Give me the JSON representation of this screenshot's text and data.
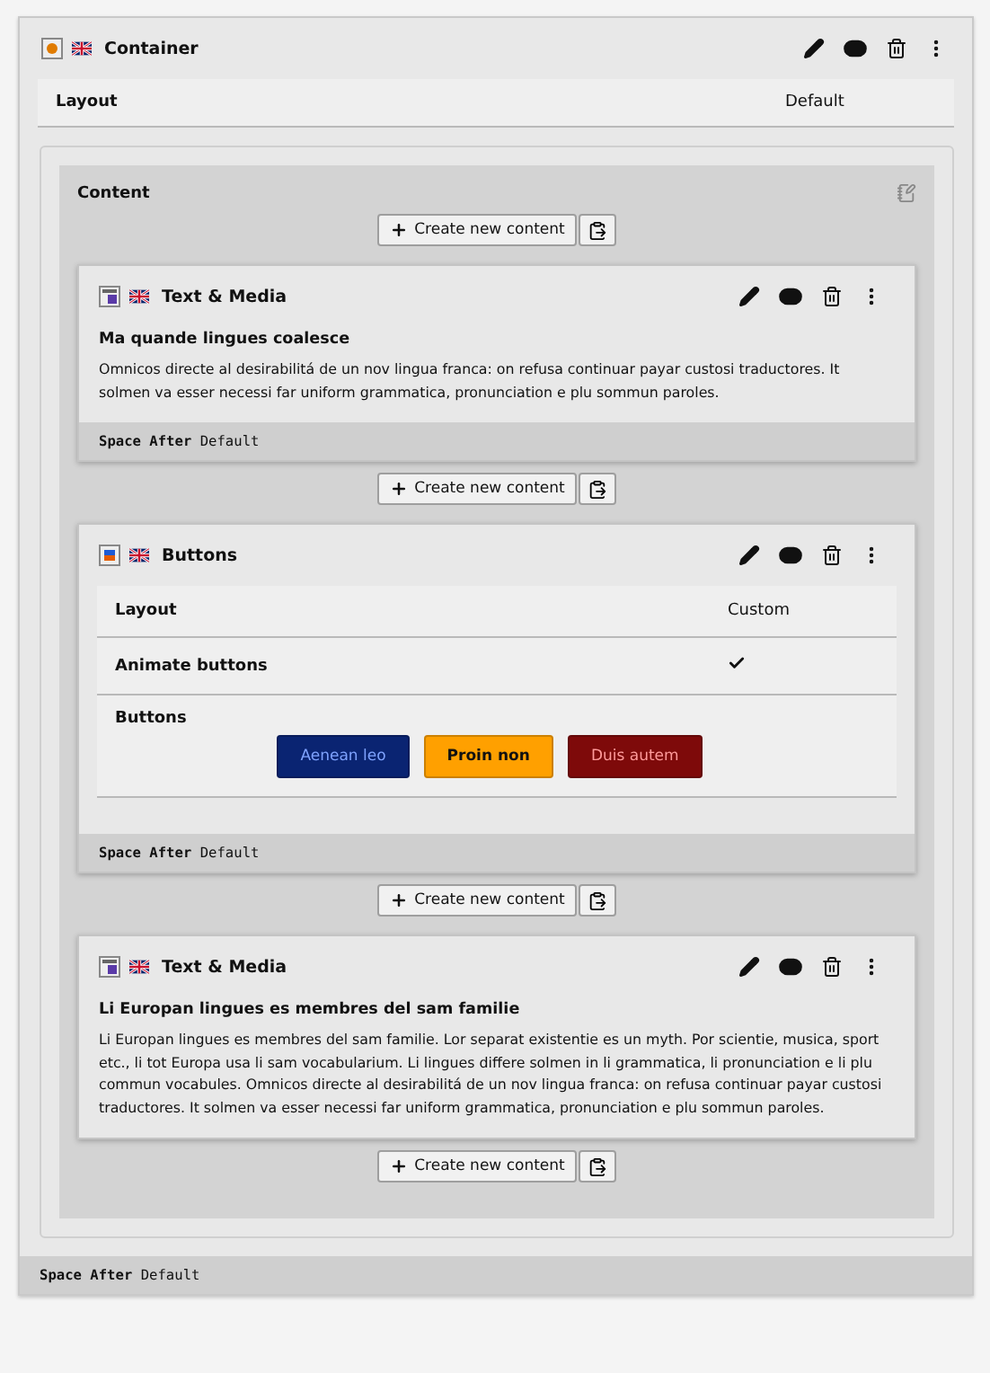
{
  "container": {
    "title": "Container",
    "layout": {
      "label": "Layout",
      "value": "Default"
    },
    "content": {
      "title": "Content",
      "create_buttons": [
        "Create new content",
        "Create new content",
        "Create new content",
        "Create new content"
      ],
      "items": [
        {
          "kind": "text_media",
          "title": "Text & Media",
          "header": "Ma quande lingues coalesce",
          "bodytext": "Omnicos directe al desirabilitá de un nov lingua franca: on refusa continuar payar custosi traductores. It solmen va esser necessi far uniform grammatica, pronunciation e plu sommun paroles.",
          "footer": {
            "label": "Space After",
            "value": "Default"
          }
        },
        {
          "kind": "buttons",
          "title": "Buttons",
          "fields": [
            {
              "kind": "text",
              "label": "Layout",
              "value": "Custom"
            },
            {
              "kind": "check",
              "label": "Animate buttons",
              "checked": true
            },
            {
              "kind": "buttons",
              "label": "Buttons",
              "buttons": [
                {
                  "label": "Aenean leo",
                  "color": "#0a2472"
                },
                {
                  "label": "Proin non",
                  "color": "#ffa000"
                },
                {
                  "label": "Duis autem",
                  "color": "#7e0a0a"
                }
              ]
            }
          ],
          "footer": {
            "label": "Space After",
            "value": "Default"
          }
        },
        {
          "kind": "text_media",
          "title": "Text & Media",
          "header": "Li Europan lingues es membres del sam familie",
          "bodytext": "Li Europan lingues es membres del sam familie. Lor separat existentie es un myth. Por scientie, musica, sport etc., li tot Europa usa li sam vocabularium. Li lingues differe solmen in li grammatica, li pronunciation e li plu commun vocabules. Omnicos directe al desirabilitá de un nov lingua franca: on refusa continuar payar custosi traductores. It solmen va esser necessi far uniform grammatica, pronunciation e plu sommun paroles."
        }
      ]
    },
    "footer": {
      "label": "Space After",
      "value": "Default"
    }
  }
}
